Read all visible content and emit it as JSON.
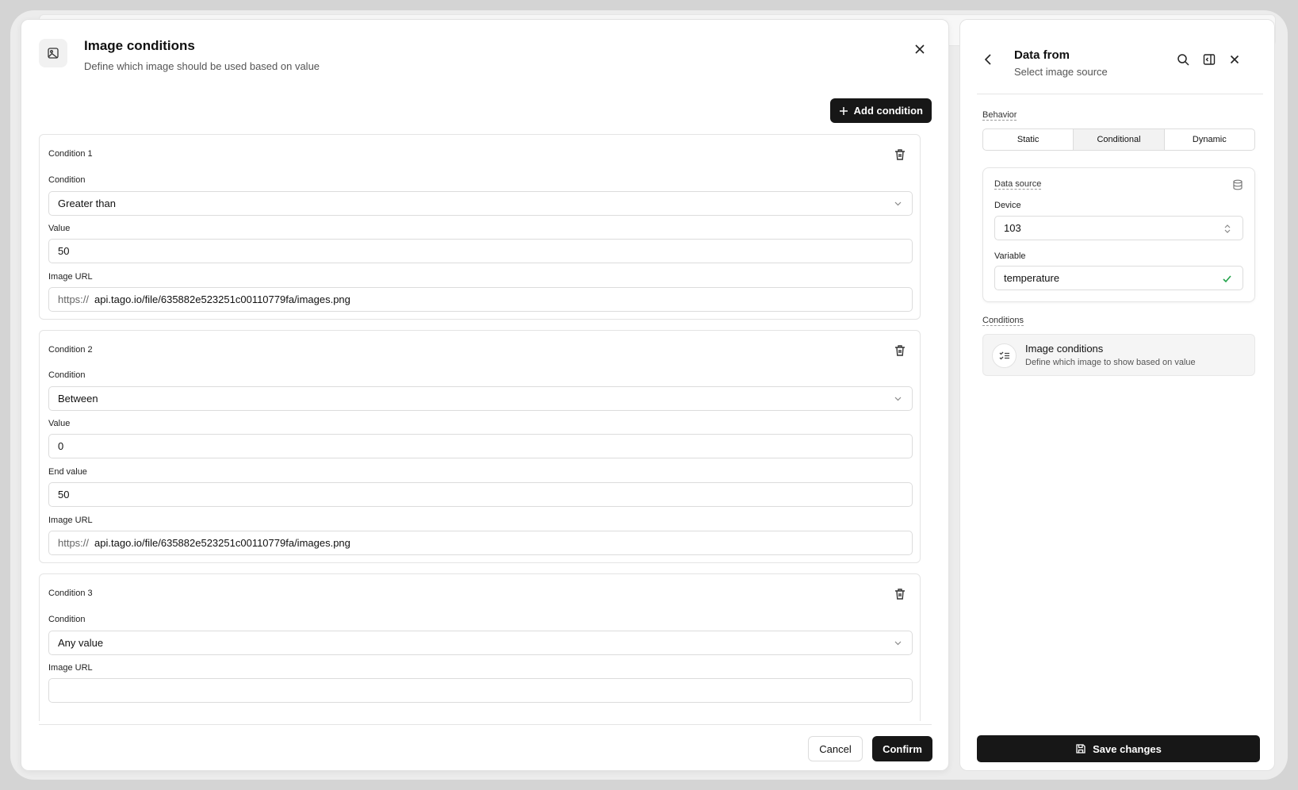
{
  "dialog": {
    "title": "Image conditions",
    "subtitle": "Define which image should be used based on value",
    "add_label": "Add condition",
    "cancel_label": "Cancel",
    "confirm_label": "Confirm",
    "conditions": [
      {
        "title": "Condition 1",
        "condition_label": "Condition",
        "condition_value": "Greater than",
        "value_label": "Value",
        "value": "50",
        "url_label": "Image URL",
        "url_prefix": "https://",
        "url": "api.tago.io/file/635882e523251c00110779fa/images.png"
      },
      {
        "title": "Condition 2",
        "condition_label": "Condition",
        "condition_value": "Between",
        "value_label": "Value",
        "value": "0",
        "end_label": "End value",
        "end_value": "50",
        "url_label": "Image URL",
        "url_prefix": "https://",
        "url": "api.tago.io/file/635882e523251c00110779fa/images.png"
      },
      {
        "title": "Condition 3",
        "condition_label": "Condition",
        "condition_value": "Any value",
        "url_label": "Image URL"
      }
    ]
  },
  "panel": {
    "title": "Data from",
    "subtitle": "Select image source",
    "behavior_label": "Behavior",
    "tabs": [
      "Static",
      "Conditional",
      "Dynamic"
    ],
    "active_tab": "Conditional",
    "data_source_label": "Data source",
    "device_label": "Device",
    "device_value": "103",
    "variable_label": "Variable",
    "variable_value": "temperature",
    "conditions_label": "Conditions",
    "cond_item_title": "Image conditions",
    "cond_item_sub": "Define which image to show based on value",
    "save_label": "Save changes"
  },
  "colors": {
    "primary": "#171717",
    "check": "#22a34a",
    "border": "#dcdcdc"
  }
}
